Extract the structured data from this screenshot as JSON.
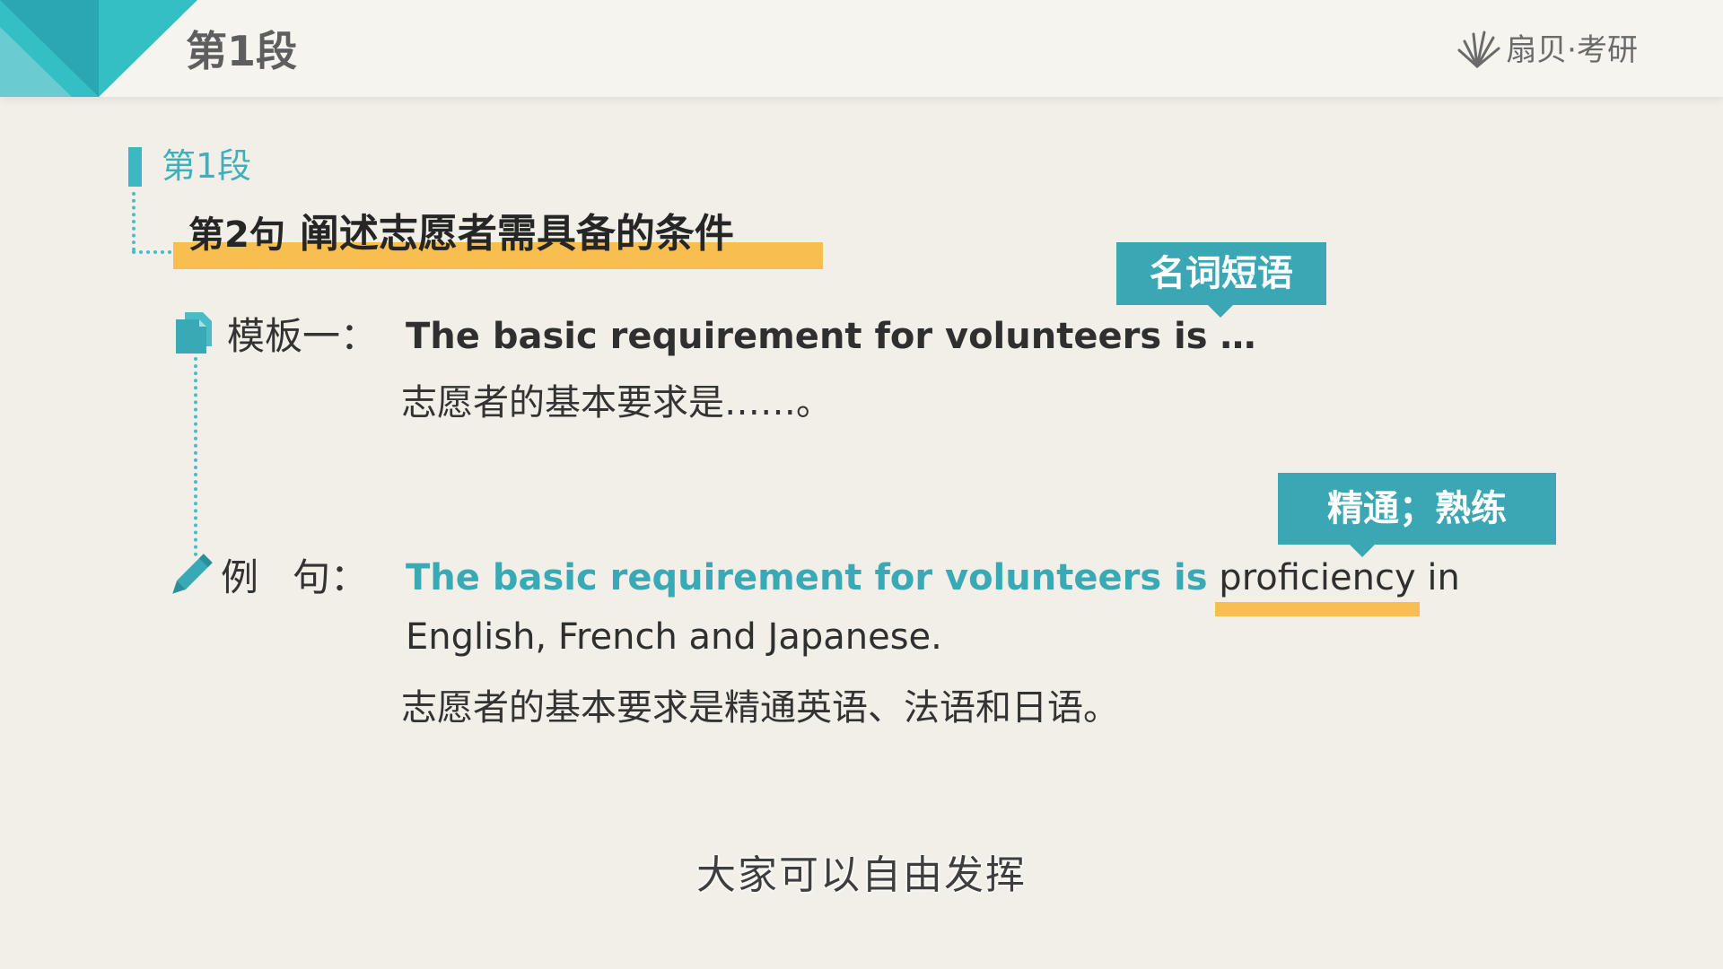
{
  "header": {
    "title": "第1段",
    "logo_text": "扇贝·考研"
  },
  "section": {
    "label": "第1段",
    "sentence_num": "第2句",
    "sentence_title": "阐述志愿者需具备的条件"
  },
  "tags": {
    "noun_phrase": "名词短语",
    "proficiency": "精通；熟练"
  },
  "template": {
    "label": "模板一：",
    "english": "The basic requirement for volunteers is …",
    "chinese": "志愿者的基本要求是……。"
  },
  "example": {
    "label_first": "例",
    "label_second": "句：",
    "english_teal": "The basic requirement for volunteers is",
    "english_highlight": "proficiency",
    "english_rest": "in",
    "english_line2": "English, French and Japanese.",
    "chinese": "志愿者的基本要求是精通英语、法语和日语。"
  },
  "subtitle": "大家可以自由发挥",
  "colors": {
    "teal": "#3aa9b6",
    "highlight": "#f8be4f",
    "background": "#f1efe7"
  },
  "icons": {
    "document": "document-icon",
    "pencil": "pencil-icon",
    "logo": "fan-logo-icon"
  }
}
